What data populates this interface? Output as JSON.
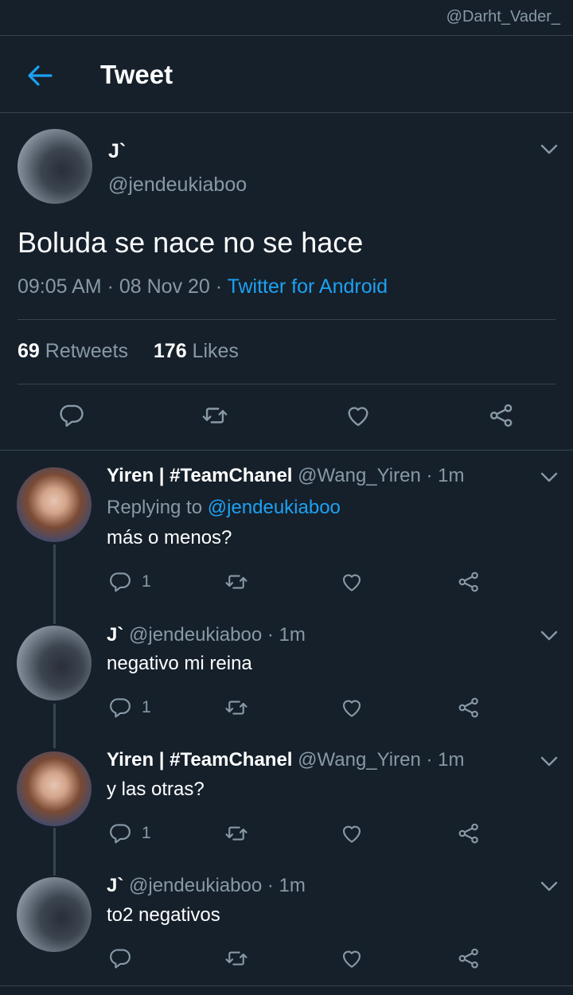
{
  "watermark": "@Darht_Vader_",
  "header": {
    "title": "Tweet"
  },
  "main_tweet": {
    "name": "J`",
    "handle": "@jendeukiaboo",
    "text": "Boluda se nace no se hace",
    "time": "09:05 AM",
    "date": "08 Nov 20",
    "separator": " · ",
    "source": "Twitter for Android",
    "retweets": "69",
    "retweets_label": " Retweets",
    "likes": "176",
    "likes_label": " Likes"
  },
  "replies": [
    {
      "name": "Yiren | #TeamChanel",
      "handle": "@Wang_Yiren · 1m",
      "replying_label": "Replying to ",
      "replying_to": "@jendeukiaboo",
      "text": "más o menos?",
      "reply_count": "1"
    },
    {
      "name": "J`",
      "handle": "@jendeukiaboo · 1m",
      "text": "negativo mi reina",
      "reply_count": "1"
    },
    {
      "name": "Yiren | #TeamChanel",
      "handle": "@Wang_Yiren · 1m",
      "text": "y las otras?",
      "reply_count": "1"
    },
    {
      "name": "J`",
      "handle": "@jendeukiaboo · 1m",
      "text": "to2 negativos",
      "reply_count": ""
    }
  ],
  "colors": {
    "background": "#15202b",
    "accent": "#1da1f2",
    "secondary_text": "#8899a6",
    "divider": "#38444d"
  }
}
